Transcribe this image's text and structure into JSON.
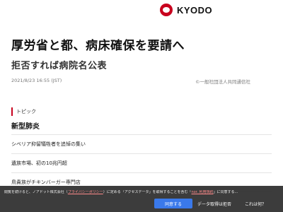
{
  "header": {
    "logo_text": "KYODO"
  },
  "article": {
    "headline": "厚労省と都、病床確保を要請へ",
    "subhead": "拒否すれば病院名公表",
    "date": "2021/8/23 16:55 (JST)",
    "copyright": "©一般社団法人共同通信社"
  },
  "topic": {
    "label": "トピック",
    "title": "新型肺炎",
    "items": [
      {
        "label": "シベリア抑留犠牲者を追悼の集い"
      },
      {
        "label": "遺族市場、初の10兆円超"
      },
      {
        "label": "鳥貴族がチキンバーガー専門店"
      }
    ]
  },
  "consent": {
    "text_before": "閲覧を続けると、ノアドット株式会社（",
    "privacy_link": "プライバシーポリシー",
    "text_middle": "）に定める「アクセスデータ」を取得することを含む「",
    "terms_link": "nor. 利用規約",
    "text_after": "」に同意する...",
    "accept_label": "同意する",
    "settings_label": "データ取得は拒否",
    "about_label": "これは何？"
  }
}
